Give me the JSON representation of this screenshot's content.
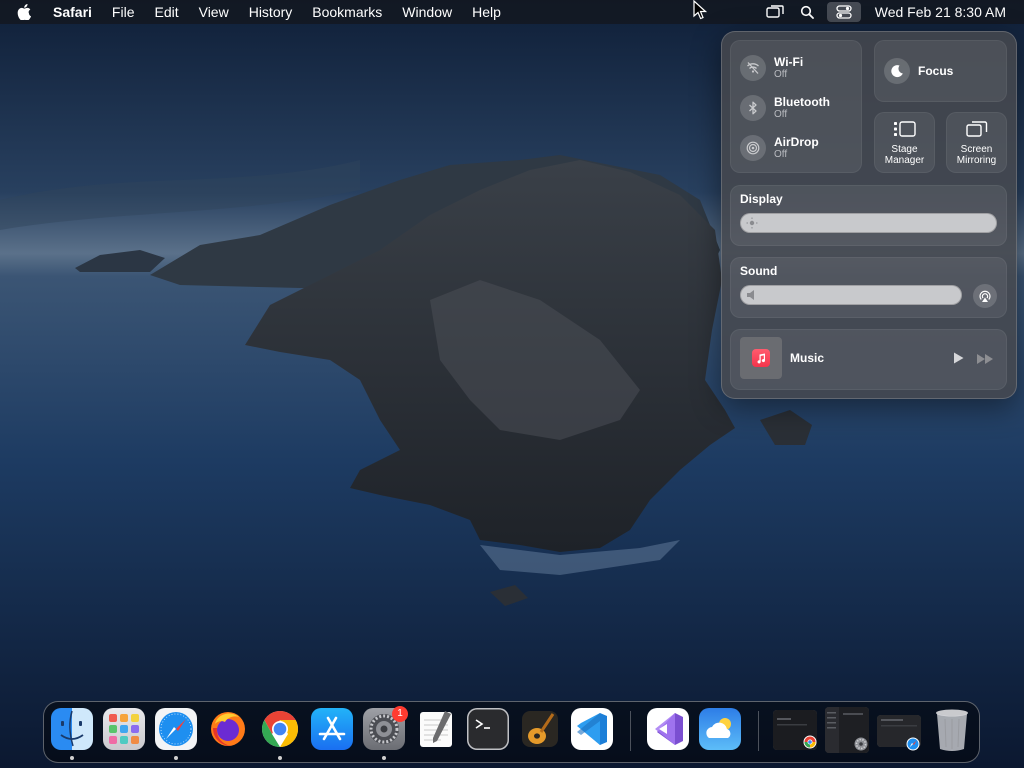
{
  "menubar": {
    "app_name": "Safari",
    "menus": [
      "File",
      "Edit",
      "View",
      "History",
      "Bookmarks",
      "Window",
      "Help"
    ],
    "clock": "Wed Feb 21  8:30 AM",
    "status_icons": [
      "screen-mirroring-icon",
      "spotlight-search-icon",
      "control-center-icon"
    ]
  },
  "control_center": {
    "wifi": {
      "title": "Wi-Fi",
      "status": "Off",
      "icon": "wifi-off-icon"
    },
    "bluetooth": {
      "title": "Bluetooth",
      "status": "Off",
      "icon": "bluetooth-icon"
    },
    "airdrop": {
      "title": "AirDrop",
      "status": "Off",
      "icon": "airdrop-icon"
    },
    "focus": {
      "title": "Focus",
      "icon": "moon-icon"
    },
    "stage_manager": {
      "line1": "Stage",
      "line2": "Manager",
      "icon": "stage-manager-icon"
    },
    "screen_mirroring": {
      "line1": "Screen",
      "line2": "Mirroring",
      "icon": "screen-mirroring-icon"
    },
    "display": {
      "title": "Display",
      "level": 0.02
    },
    "sound": {
      "title": "Sound",
      "level": 0.02
    },
    "music": {
      "title": "Music",
      "icon": "music-note-icon"
    }
  },
  "dock": {
    "apps": [
      {
        "name": "Finder",
        "running": true
      },
      {
        "name": "Launchpad",
        "running": false
      },
      {
        "name": "Safari",
        "running": true
      },
      {
        "name": "Firefox",
        "running": false
      },
      {
        "name": "Google Chrome",
        "running": true
      },
      {
        "name": "App Store",
        "running": false
      },
      {
        "name": "System Settings",
        "running": true,
        "badge": "1"
      },
      {
        "name": "TextEdit",
        "running": false
      },
      {
        "name": "Terminal",
        "running": false
      },
      {
        "name": "GarageBand",
        "running": false
      },
      {
        "name": "Visual Studio Code",
        "running": false
      },
      {
        "name": "Visual Studio",
        "running": false
      },
      {
        "name": "Weather",
        "running": false
      }
    ],
    "minimized_windows": [
      "Chrome window",
      "System Settings window",
      "Safari window"
    ],
    "trash": "Trash"
  },
  "colors": {
    "menubar_bg": "#14161c",
    "panel_bg": "#46484e",
    "badge_red": "#ff3b30"
  }
}
